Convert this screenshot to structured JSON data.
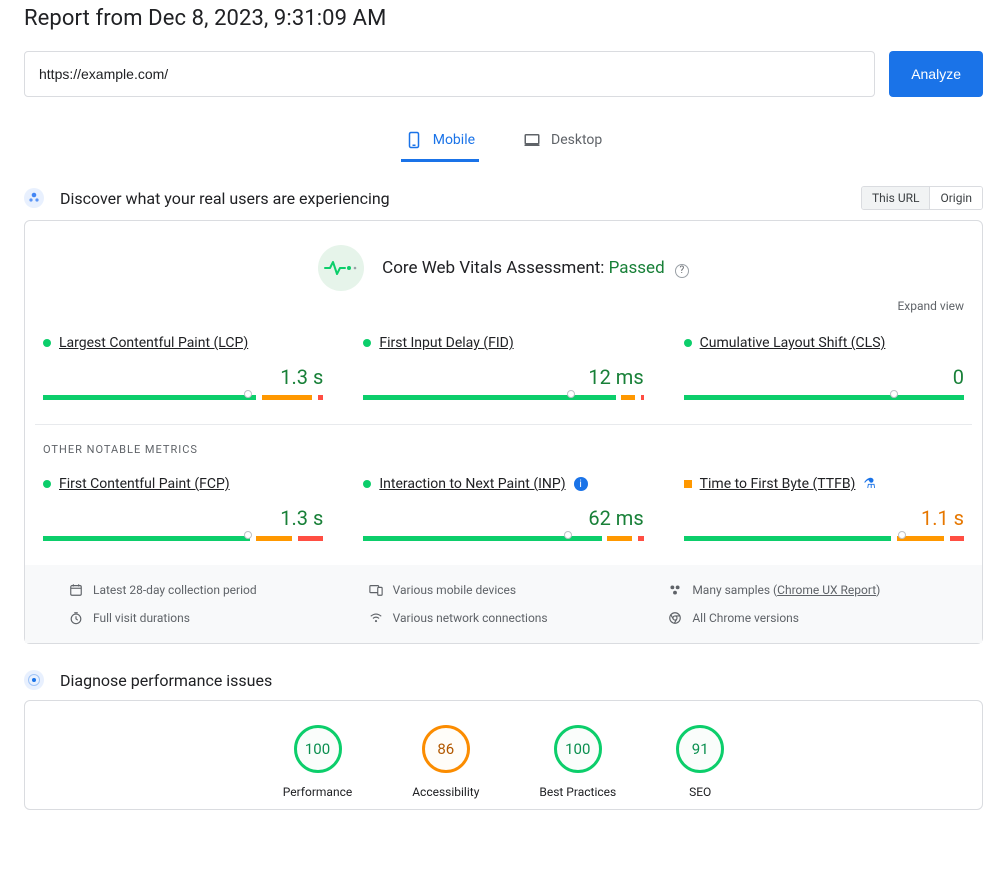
{
  "header": {
    "title": "Report from Dec 8, 2023, 9:31:09 AM"
  },
  "url_input": {
    "value": "https://example.com/"
  },
  "analyze_label": "Analyze",
  "tabs": {
    "mobile": "Mobile",
    "desktop": "Desktop"
  },
  "discover_section": {
    "title": "Discover what your real users are experiencing",
    "toggle": {
      "this_url": "This URL",
      "origin": "Origin"
    }
  },
  "vitals": {
    "label": "Core Web Vitals Assessment: ",
    "status": "Passed",
    "expand": "Expand view"
  },
  "metrics_primary": [
    {
      "name": "Largest Contentful Paint (LCP)",
      "value": "1.3 s",
      "color": "green",
      "pointer": 73,
      "segs": [
        76,
        2,
        18,
        2,
        2
      ]
    },
    {
      "name": "First Input Delay (FID)",
      "value": "12 ms",
      "color": "green",
      "pointer": 74,
      "segs": [
        90,
        2,
        5,
        2,
        1
      ]
    },
    {
      "name": "Cumulative Layout Shift (CLS)",
      "value": "0",
      "color": "green",
      "pointer": 75,
      "segs": [
        100,
        0,
        0,
        0,
        0
      ]
    }
  ],
  "other_metrics_label": "OTHER NOTABLE METRICS",
  "metrics_secondary": [
    {
      "name": "First Contentful Paint (FCP)",
      "value": "1.3 s",
      "color": "green",
      "status": "green",
      "pointer": 73,
      "segs": [
        74,
        2,
        13,
        2,
        9
      ]
    },
    {
      "name": "Interaction to Next Paint (INP)",
      "value": "62 ms",
      "color": "green",
      "status": "green",
      "info": true,
      "pointer": 73,
      "segs": [
        85,
        2,
        9,
        2,
        2
      ]
    },
    {
      "name": "Time to First Byte (TTFB)",
      "value": "1.1 s",
      "color": "orange",
      "status": "orange",
      "flask": true,
      "pointer": 78,
      "segs": [
        74,
        2,
        17,
        2,
        5
      ]
    }
  ],
  "meta": {
    "period": "Latest 28-day collection period",
    "devices": "Various mobile devices",
    "samples_pre": "Many samples (",
    "samples_link": "Chrome UX Report",
    "samples_post": ")",
    "durations": "Full visit durations",
    "network": "Various network connections",
    "versions": "All Chrome versions"
  },
  "diagnose_section": {
    "title": "Diagnose performance issues"
  },
  "gauges": [
    {
      "score": "100",
      "label": "Performance",
      "style": "green"
    },
    {
      "score": "86",
      "label": "Accessibility",
      "style": "orange"
    },
    {
      "score": "100",
      "label": "Best Practices",
      "style": "green"
    },
    {
      "score": "91",
      "label": "SEO",
      "style": "green"
    }
  ]
}
